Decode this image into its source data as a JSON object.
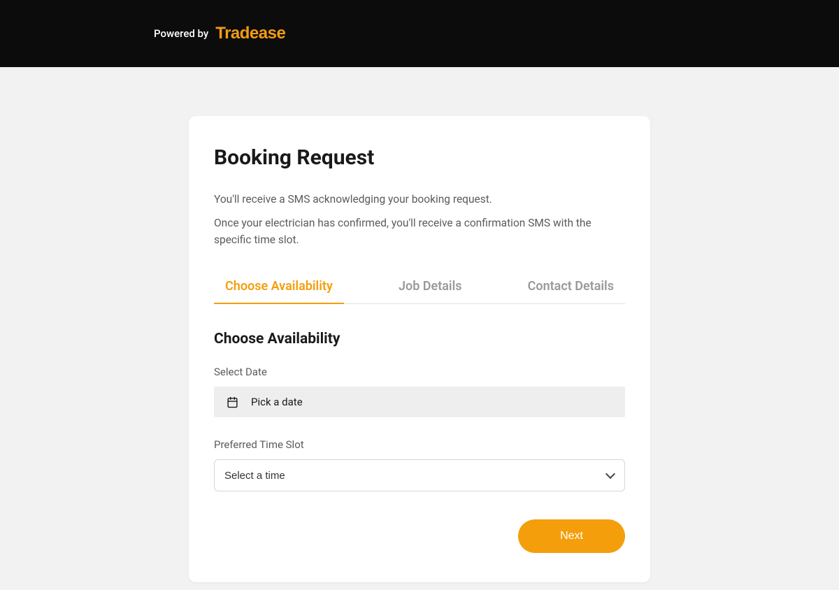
{
  "header": {
    "powered_by": "Powered by",
    "brand": "Tradease"
  },
  "card": {
    "title": "Booking Request",
    "intro_line_1": "You'll receive a SMS acknowledging your booking request.",
    "intro_line_2": "Once your electrician has confirmed, you'll receive a confirmation SMS with the specific time slot."
  },
  "tabs": [
    {
      "label": "Choose Availability",
      "active": true
    },
    {
      "label": "Job Details",
      "active": false
    },
    {
      "label": "Contact Details",
      "active": false
    }
  ],
  "section": {
    "title": "Choose Availability",
    "date_label": "Select Date",
    "date_placeholder": "Pick a date",
    "time_label": "Preferred Time Slot",
    "time_placeholder": "Select a time"
  },
  "actions": {
    "next": "Next"
  },
  "colors": {
    "accent": "#f59e0b"
  }
}
